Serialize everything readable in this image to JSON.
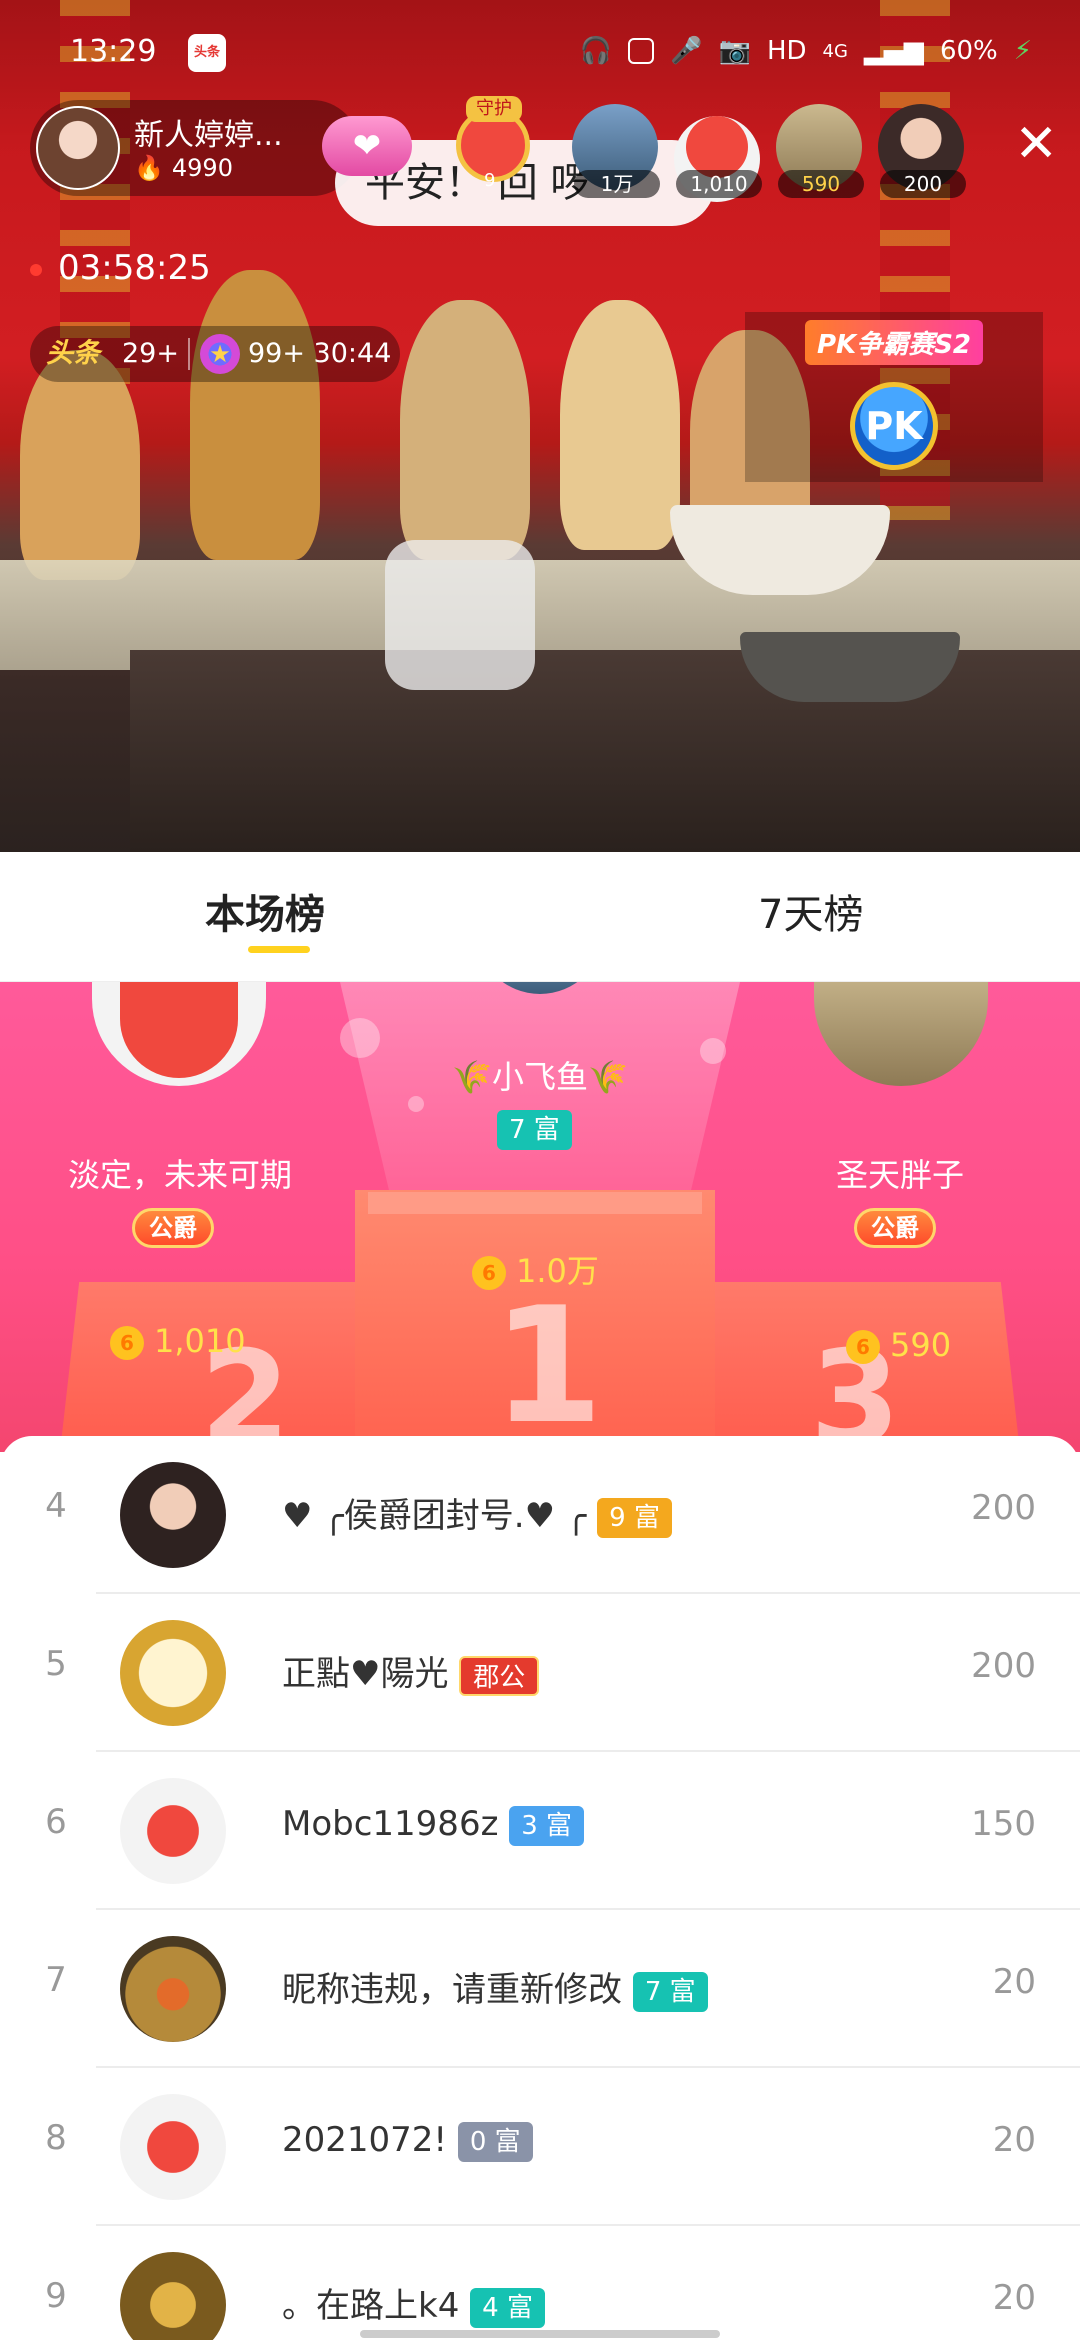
{
  "status_bar": {
    "time": "13:29",
    "app_icon_label": "头条",
    "right_text": "HD",
    "network": "4G",
    "battery": "60%"
  },
  "anchor": {
    "name": "新人婷婷...",
    "heat": "4990"
  },
  "bubble_text": "平安！ 回 啰",
  "guard_badge": {
    "label": "守护",
    "level": "9"
  },
  "top_viewers": [
    {
      "value": "1万"
    },
    {
      "value": "1,010"
    },
    {
      "value": "590"
    },
    {
      "value": "200"
    }
  ],
  "live_timer": "03:58:25",
  "badges": {
    "headline_label": "头条",
    "headline_count": "29+",
    "star_count": "99+ 30:44"
  },
  "pk": {
    "title": "PK争霸赛S2",
    "button": "PK"
  },
  "tabs": [
    {
      "label": "本场榜",
      "active": true
    },
    {
      "label": "7天榜",
      "active": false
    }
  ],
  "podium": {
    "first": {
      "name": "小飞鱼",
      "rich": "7 富",
      "coins": "1.0万",
      "block": "1"
    },
    "second": {
      "name": "淡定，未来可期",
      "title_badge": "公爵",
      "coins": "1,010",
      "block": "2"
    },
    "third": {
      "name": "圣天胖子",
      "title_badge": "公爵",
      "coins": "590",
      "block": "3"
    },
    "coin_glyph": "6"
  },
  "ranking": [
    {
      "rank": "4",
      "name": "♥ ╭侯爵团封号.♥ ╭",
      "badge": "9 富",
      "badge_color": "#f4a81e",
      "score": "200"
    },
    {
      "rank": "5",
      "name": "正點♥陽光",
      "badge": "郡公",
      "badge_color": "#e43a2d",
      "score": "200"
    },
    {
      "rank": "6",
      "name": "Mobc11986z",
      "badge": "3 富",
      "badge_color": "#4aa3f0",
      "score": "150"
    },
    {
      "rank": "7",
      "name": "昵称违规，请重新修改",
      "badge": "7 富",
      "badge_color": "#16c2b2",
      "score": "20"
    },
    {
      "rank": "8",
      "name": "2021072!",
      "badge": "0 富",
      "badge_color": "#8a93a8",
      "score": "20"
    },
    {
      "rank": "9",
      "name": "。在路上k4",
      "badge": "4 富",
      "badge_color": "#16c2b2",
      "score": "20"
    }
  ],
  "colors": {
    "accent": "#ffd21f",
    "podium_pink": "#ff5a9a",
    "coin": "#ffc21f"
  }
}
